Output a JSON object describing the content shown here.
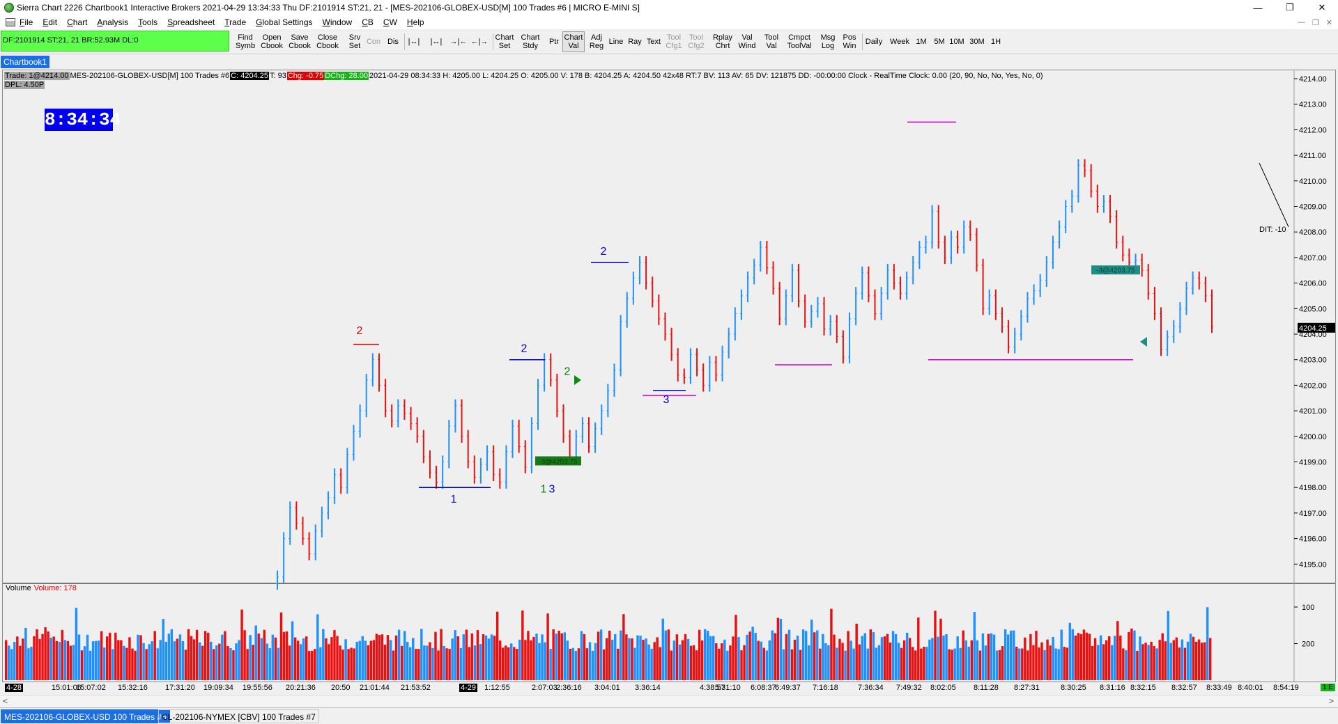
{
  "window": {
    "title": "Sierra Chart 2226 Chartbook1  Interactive Brokers 2021-04-29  13:34:33 Thu  DF:2101914  ST:21, 21 - [MES-202106-GLOBEX-USD[M]  100 Trades  #6 | MICRO E-MINI S]",
    "controls": [
      "—",
      "❐",
      "✕"
    ],
    "mdi_controls": [
      "—",
      "❐",
      "✕"
    ]
  },
  "menu": [
    "File",
    "Edit",
    "Chart",
    "Analysis",
    "Tools",
    "Spreadsheet",
    "Trade",
    "Global Settings",
    "Window",
    "CB",
    "CW",
    "Help"
  ],
  "status_panel": "DF:2101914  ST:21, 21  BR:52.93M  DL:0",
  "toolbar": [
    {
      "label": "Find\nSymb",
      "state": ""
    },
    {
      "label": "Open\nCbook",
      "state": ""
    },
    {
      "label": "Save\nCbook",
      "state": ""
    },
    {
      "label": "Close\nCbook",
      "state": ""
    },
    {
      "label": "Srv\nSet",
      "state": ""
    },
    {
      "label": "Con",
      "state": "disabled"
    },
    {
      "label": "Dis",
      "state": ""
    },
    {
      "label": "|↔|",
      "state": ""
    },
    {
      "label": "|↔|",
      "state": ""
    },
    {
      "label": "→|←",
      "state": ""
    },
    {
      "label": "←|→",
      "state": ""
    },
    {
      "label": "Chart\nSet",
      "state": ""
    },
    {
      "label": "Chart\nStdy",
      "state": ""
    },
    {
      "label": "Ptr",
      "state": ""
    },
    {
      "label": "Chart\nVal",
      "state": "pressed"
    },
    {
      "label": "Adj\nReg",
      "state": ""
    },
    {
      "label": "Line",
      "state": ""
    },
    {
      "label": "Ray",
      "state": ""
    },
    {
      "label": "Text",
      "state": ""
    },
    {
      "label": "Tool\nCfg1",
      "state": "disabled"
    },
    {
      "label": "Tool\nCfg2",
      "state": "disabled"
    },
    {
      "label": "Rplay\nChrt",
      "state": ""
    },
    {
      "label": "Val\nWind",
      "state": ""
    },
    {
      "label": "Tool\nVal",
      "state": ""
    },
    {
      "label": "Cmpct\nToolVal",
      "state": ""
    },
    {
      "label": "Msg\nLog",
      "state": ""
    },
    {
      "label": "Pos\nWin",
      "state": ""
    },
    {
      "label": "Daily",
      "state": ""
    },
    {
      "label": "Week",
      "state": ""
    },
    {
      "label": "1M",
      "state": ""
    },
    {
      "label": "5M",
      "state": ""
    },
    {
      "label": "10M",
      "state": ""
    },
    {
      "label": "30M",
      "state": ""
    },
    {
      "label": "1H",
      "state": ""
    }
  ],
  "chartbook_tab": "Chartbook1",
  "info_line": {
    "trade": "Trade: 1@4214.00",
    "symbol": "MES-202106-GLOBEX-USD[M]  100 Trades  #6",
    "close": "C: 4204.25",
    "ticks": "T: 93",
    "chg": "Chg: -0.75",
    "dchg": "DChg: 28.00",
    "rest": "2021-04-29 08:34:33 H: 4205.00 L: 4204.25 O: 4205.00 V: 178 B: 4204.25 A: 4204.50 42x48 RT:7 BV: 113 AV: 65 DV: 121875 DD: -00:00:00 Clock - RealTime  Clock: 0.00   (20, 90, No, No, Yes, No, 0)",
    "dpl": "DPL: 4.50P"
  },
  "clock": "8:34:34",
  "price_axis": {
    "labels": [
      "4214.00",
      "4213.00",
      "4212.00",
      "4211.00",
      "4210.00",
      "4209.00",
      "4208.00",
      "4207.00",
      "4206.00",
      "4205.00",
      "4204.00",
      "4203.00",
      "4202.00",
      "4201.00",
      "4200.00",
      "4199.00",
      "4198.00",
      "4197.00",
      "4196.00",
      "4195.00"
    ],
    "last_price": "4204.25",
    "colors": {
      "last_bg": "#000000",
      "up": "#1e90ff",
      "down": "#e81010"
    }
  },
  "annotations": [
    {
      "text": "2",
      "color": "#e00000"
    },
    {
      "text": "1",
      "color": "#0000c8"
    },
    {
      "text": "2",
      "color": "#0000c8"
    },
    {
      "text": "1",
      "color": "#008000"
    },
    {
      "text": "3",
      "color": "#0000c8"
    },
    {
      "text": "2",
      "color": "#008000"
    },
    {
      "text": "2",
      "color": "#0000c8"
    },
    {
      "text": "3",
      "color": "#0000c8"
    },
    {
      "text": "-3@4203.75",
      "color": "#006400"
    },
    {
      "text": "-3@4203.75",
      "color": "#006400"
    },
    {
      "text": "DIT: -10",
      "color": "#000000"
    }
  ],
  "volume": {
    "label": "Volume",
    "value_label": "Volume: 178",
    "axis": [
      "200",
      "100"
    ]
  },
  "time_axis": {
    "labels": [
      "4-28",
      "15:01:06",
      "15:07:02",
      "15:32:16",
      "17:31:20",
      "19:09:34",
      "19:55:56",
      "20:21:36",
      "20:50",
      "21:01:44",
      "21:53:52",
      "4-29",
      "1:12:55",
      "2:07:03",
      "2:36:16",
      "3:04:01",
      "3:36:14",
      "4:38:57",
      "5:31:10",
      "6:08:37",
      "6:49:37",
      "7:16:18",
      "7:36:34",
      "7:49:32",
      "8:02:05",
      "8:11:28",
      "8:27:31",
      "8:30:25",
      "8:31:16",
      "8:32:15",
      "8:32:57",
      "8:33:49",
      "8:40:01",
      "8:54:19"
    ],
    "corner": "1 E"
  },
  "scroll": {
    "left": "<",
    "right": ">"
  },
  "bottom_tabs": [
    "MES-202106-GLOBEX-USD  100 Trades  #6",
    "CL-202106-NYMEX [CBV]  100 Trades  #7"
  ],
  "chart_data": {
    "type": "ohlc-bar",
    "ylim": [
      4194.5,
      4214.3
    ],
    "closes": [
      4194.5,
      4196.0,
      4197.2,
      4196.6,
      4196.0,
      4195.4,
      4196.3,
      4197.0,
      4197.6,
      4198.5,
      4198.0,
      4199.3,
      4200.2,
      4201.0,
      4202.2,
      4203.0,
      4202.0,
      4201.0,
      4200.6,
      4201.2,
      4200.9,
      4200.5,
      4200.0,
      4199.2,
      4198.6,
      4198.2,
      4199.0,
      4200.4,
      4201.2,
      4200.0,
      4199.0,
      4198.4,
      4198.9,
      4199.4,
      4198.5,
      4198.2,
      4199.4,
      4200.4,
      4199.6,
      4198.8,
      4200.5,
      4202.0,
      4203.0,
      4202.2,
      4201.0,
      4200.0,
      4199.2,
      4200.0,
      4200.5,
      4199.6,
      4200.3,
      4201.0,
      4201.8,
      4202.6,
      4204.5,
      4205.4,
      4206.2,
      4206.8,
      4206.0,
      4205.3,
      4204.6,
      4204.0,
      4203.2,
      4202.4,
      4202.3,
      4203.2,
      4202.6,
      4202.0,
      4202.9,
      4202.4,
      4203.3,
      4204.0,
      4204.8,
      4205.5,
      4206.2,
      4206.7,
      4207.4,
      4206.6,
      4205.8,
      4204.6,
      4205.5,
      4206.5,
      4205.3,
      4204.5,
      4204.9,
      4205.2,
      4204.2,
      4204.5,
      4203.9,
      4203.1,
      4204.6,
      4205.6,
      4206.4,
      4205.5,
      4204.8,
      4205.6,
      4206.5,
      4206.0,
      4205.6,
      4206.2,
      4206.8,
      4207.4,
      4207.6,
      4208.8,
      4207.6,
      4207.0,
      4207.8,
      4207.4,
      4208.2,
      4207.9,
      4206.7,
      4205.0,
      4205.5,
      4204.8,
      4204.3,
      4203.5,
      4204.0,
      4204.7,
      4205.4,
      4205.7,
      4206.1,
      4206.8,
      4207.6,
      4208.2,
      4209.0,
      4209.4,
      4210.6,
      4210.4,
      4209.6,
      4209.0,
      4209.2,
      4208.6,
      4207.6,
      4207.1,
      4206.8,
      4206.9,
      4206.5,
      4205.6,
      4204.8,
      4203.4,
      4203.9,
      4204.3,
      4205.0,
      4205.8,
      4206.2,
      4206.0,
      4205.5,
      4204.3
    ],
    "volume_range": [
      0,
      240
    ],
    "volume_axis_ticks": [
      100,
      200
    ]
  }
}
